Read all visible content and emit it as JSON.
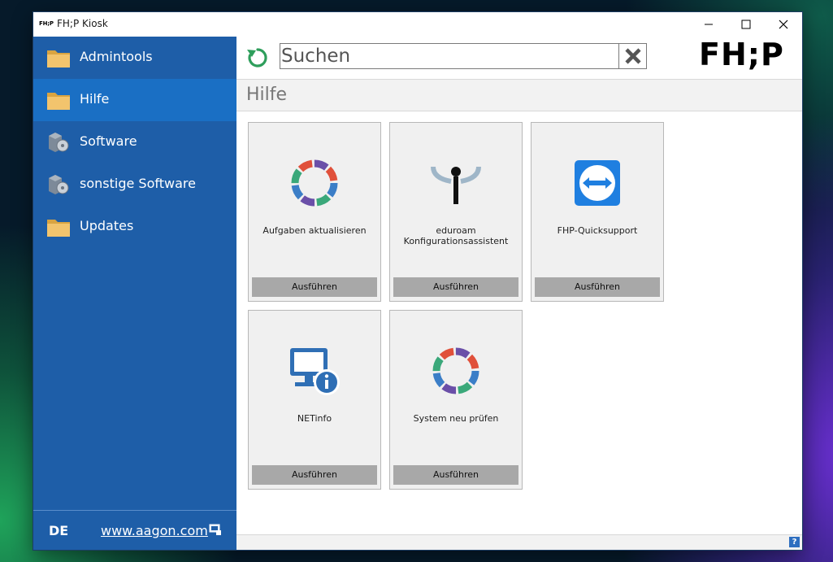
{
  "window": {
    "app_icon_text": "FH;P",
    "title": "FH;P Kiosk"
  },
  "sidebar": {
    "items": [
      {
        "label": "Admintools",
        "icon": "folder-icon"
      },
      {
        "label": "Hilfe",
        "icon": "folder-icon",
        "active": true
      },
      {
        "label": "Software",
        "icon": "software-box-icon"
      },
      {
        "label": "sonstige Software",
        "icon": "software-box-icon"
      },
      {
        "label": "Updates",
        "icon": "folder-icon"
      }
    ],
    "footer": {
      "language": "DE",
      "link": "www.aagon.com"
    }
  },
  "search": {
    "placeholder": "Suchen"
  },
  "logo_text": "FH;P",
  "section": {
    "title": "Hilfe"
  },
  "tiles": [
    {
      "label": "Aufgaben aktualisieren",
      "button": "Ausführen",
      "icon": "ring-icon"
    },
    {
      "label": "eduroam Konfigurationsassistent",
      "button": "Ausführen",
      "icon": "eduroam-icon"
    },
    {
      "label": "FHP-Quicksupport",
      "button": "Ausführen",
      "icon": "teamviewer-icon"
    },
    {
      "label": "NETinfo",
      "button": "Ausführen",
      "icon": "netinfo-icon"
    },
    {
      "label": "System neu prüfen",
      "button": "Ausführen",
      "icon": "ring-icon"
    }
  ],
  "colors": {
    "sidebar_bg": "#1e5ea8",
    "sidebar_active": "#1a6fc4",
    "refresh_green": "#2e9e5b",
    "tile_button": "#a8a8a8"
  }
}
